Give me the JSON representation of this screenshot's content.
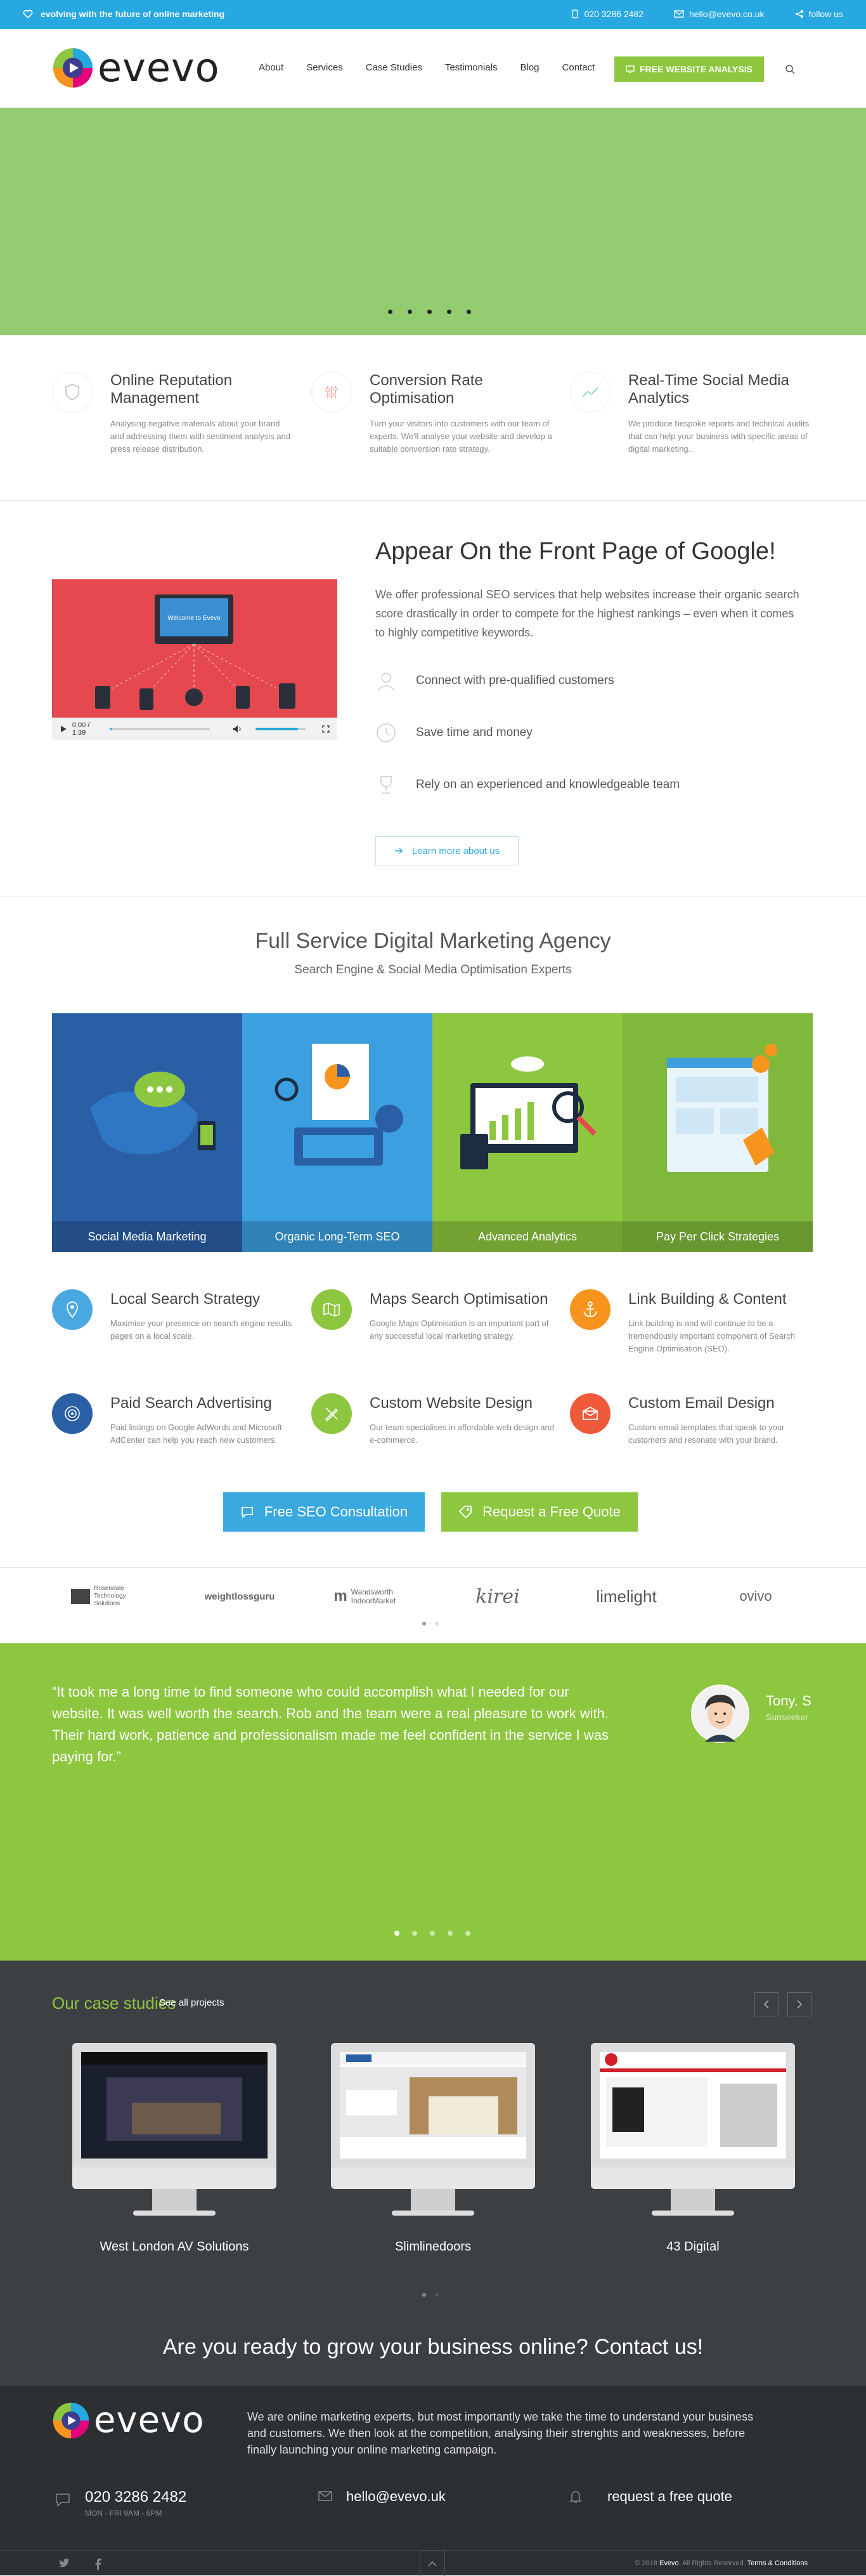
{
  "topbar": {
    "tagline": "evolving with the future of online marketing",
    "phone": "020 3286 2482",
    "email": "hello@evevo.co.uk",
    "follow": "follow us"
  },
  "header": {
    "logo": "evevo",
    "nav": [
      "About",
      "Services",
      "Case Studies",
      "Testimonials",
      "Blog",
      "Contact"
    ],
    "cta": "FREE WEBSITE ANALYSIS"
  },
  "hero": {
    "slides": 5,
    "active": 0
  },
  "features": [
    {
      "title": "Online Reputation Management",
      "text": "Analysing negative materials about your brand and addressing them with sentiment analysis and press release distribution.",
      "icon": "shield-icon"
    },
    {
      "title": "Conversion Rate Optimisation",
      "text": "Turn your visitors into customers with our team of experts. We'll analyse your website and develop a suitable conversion rate strategy.",
      "icon": "sliders-icon"
    },
    {
      "title": "Real-Time Social Media Analytics",
      "text": "We produce bespoke reports and technical audits that can help your business with specific areas of digital marketing.",
      "icon": "chart-line-icon"
    }
  ],
  "seo": {
    "title": "Appear On the Front Page of Google!",
    "lead": "We offer professional SEO services that help websites increase their organic search score drastically in order to compete for the highest rankings – even when it comes to highly competitive keywords.",
    "bullets": [
      "Connect with pre-qualified customers",
      "Save time and money",
      "Rely on an experienced and knowledgeable team"
    ],
    "button": "Learn more about us",
    "video": {
      "time": "0:00 / 1:39",
      "banner": "Welcome to Evevo",
      "progress": 0.02,
      "volume": 0.85
    }
  },
  "agency": {
    "title": "Full Service Digital Marketing Agency",
    "subtitle": "Search Engine & Social Media Optimisation Experts",
    "tiles": [
      {
        "label": "Social Media Marketing",
        "color": "#2a5fa5"
      },
      {
        "label": "Organic Long-Term SEO",
        "color": "#3b9fe0"
      },
      {
        "label": "Advanced Analytics",
        "color": "#8dc63f"
      },
      {
        "label": "Pay Per Click Strategies",
        "color": "#7fb83a"
      }
    ],
    "services": [
      {
        "title": "Local Search Strategy",
        "text": "Maximise your presence on search engine results pages on a local scale.",
        "color": "#4aa8e0",
        "icon": "map-pin-icon"
      },
      {
        "title": "Maps Search Optimisation",
        "text": "Google Maps Optimisation is an important part of any successful local marketing strategy.",
        "color": "#8dc63f",
        "icon": "map-icon"
      },
      {
        "title": "Link Building & Content",
        "text": "Link building is and will continue to be a tremendously important component of Search Engine Optimisation (SEO).",
        "color": "#f7941d",
        "icon": "anchor-icon"
      },
      {
        "title": "Paid Search Advertising",
        "text": "Paid listings on Google AdWords and Microsoft AdCenter can help you reach new customers.",
        "color": "#2a5fa5",
        "icon": "target-icon"
      },
      {
        "title": "Custom Website Design",
        "text": "Our team specialises in affordable web design and e-commerce.",
        "color": "#8dc63f",
        "icon": "pencil-ruler-icon"
      },
      {
        "title": "Custom Email Design",
        "text": "Custom email templates that speak to your customers and resonate with your brand.",
        "color": "#ee5a3a",
        "icon": "envelope-icon"
      }
    ],
    "btn_consult": "Free SEO Consultation",
    "btn_quote": "Request a Free Quote"
  },
  "clients": [
    "Rosendale Technology Solutions",
    "weightlossguru",
    "Wandsworth IndoorMarket",
    "kirei",
    "limelight",
    "ovivo"
  ],
  "testimonial": {
    "quote": "“It took me a long time to find someone who could accomplish what I needed for our website. It was well worth the search. Rob and the team were a real pleasure to work with. Their hard work, patience and professionalism made me feel confident in the service I was paying for.”",
    "name": "Tony. S",
    "company": "Sunseeker"
  },
  "cases": {
    "title": "Our case studies",
    "all": "See all projects",
    "items": [
      "West London AV Solutions",
      "Slimlinedoors",
      "43 Digital"
    ]
  },
  "ready": "Are you ready to grow your business online? Contact us!",
  "footer": {
    "logo": "evevo",
    "about": "We are online marketing experts, but most importantly we take the time to understand your business and customers. We then look at the competition, analysing their strenghts and weaknesses, before finally launching your online marketing campaign.",
    "phone": "020 3286 2482",
    "hours": "MON - FRI 9AM - 6PM",
    "email": "hello@evevo.uk",
    "quote": "request a free quote",
    "copy_prefix": "© 2018",
    "copy_brand": "Evevo",
    "copy_rest": ". All Rights Reserved.",
    "copy_terms": "Terms & Conditions"
  }
}
